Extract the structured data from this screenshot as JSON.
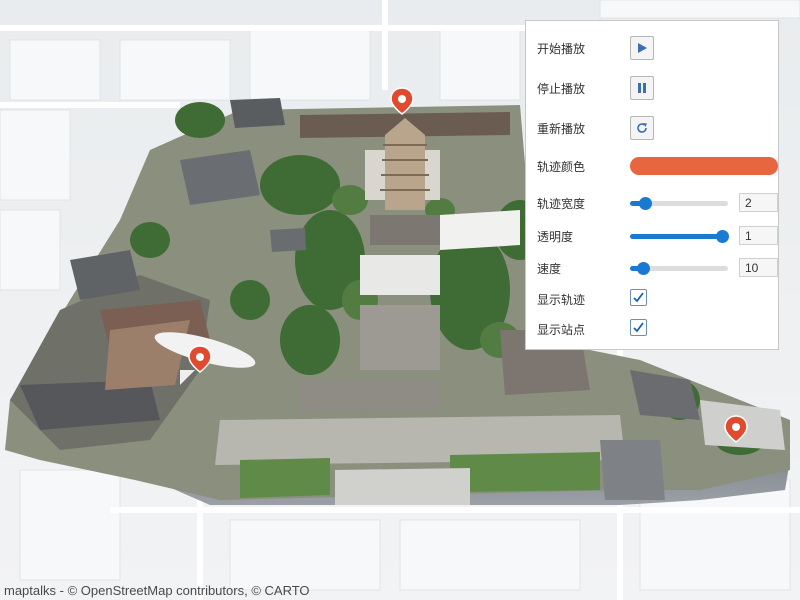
{
  "panel": {
    "start": {
      "label": "开始播放",
      "icon": "play-icon"
    },
    "stop": {
      "label": "停止播放",
      "icon": "pause-icon"
    },
    "restart": {
      "label": "重新播放",
      "icon": "refresh-icon"
    },
    "trail_color": {
      "label": "轨迹颜色",
      "value": "#e8663f"
    },
    "trail_width": {
      "label": "轨迹宽度",
      "value": "2",
      "fraction": 0.15
    },
    "opacity": {
      "label": "透明度",
      "value": "1",
      "fraction": 0.94
    },
    "speed": {
      "label": "速度",
      "value": "10",
      "fraction": 0.13
    },
    "show_trail": {
      "label": "显示轨迹",
      "checked": true
    },
    "show_stations": {
      "label": "显示站点",
      "checked": true
    }
  },
  "attribution": {
    "lib": "maptalks",
    "sep1": " - © ",
    "osm": "OpenStreetMap contributors",
    "sep2": ", © ",
    "carto": "CARTO"
  },
  "colors": {
    "accent": "#1a7ad2",
    "marker": "#e04a2f",
    "trail": "#e8663f"
  }
}
